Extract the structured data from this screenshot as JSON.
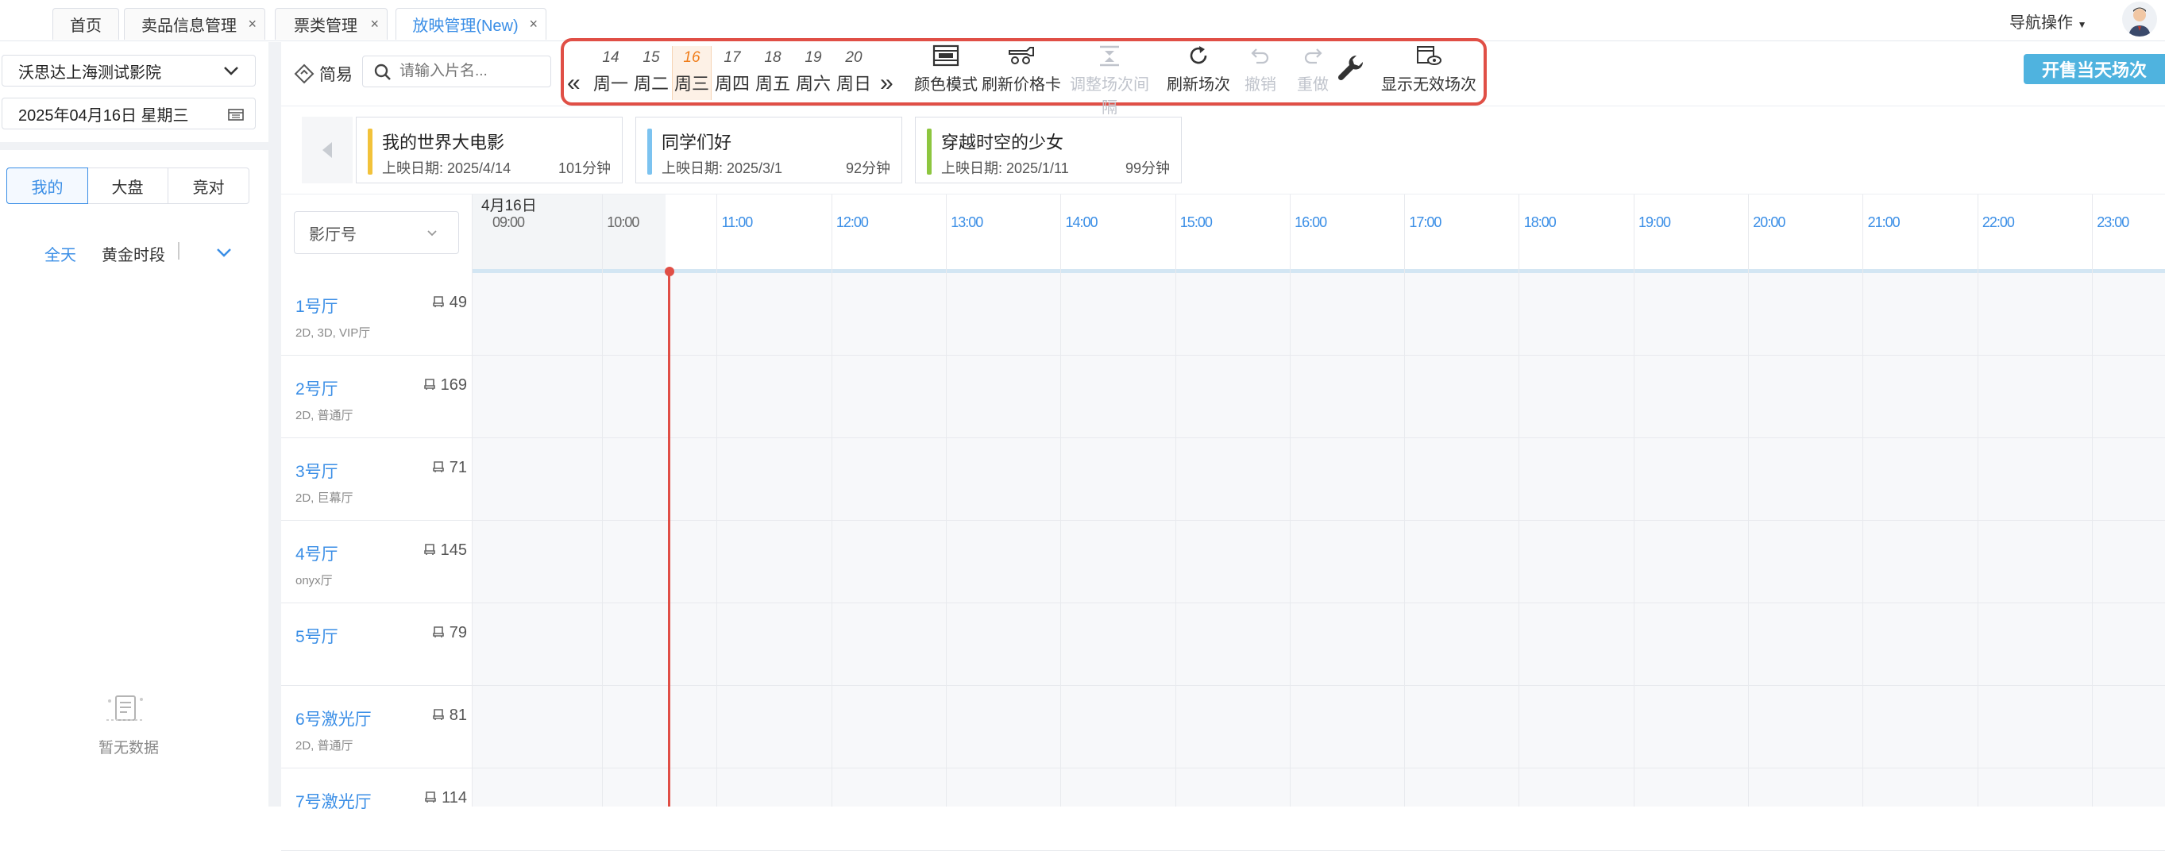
{
  "tabs": [
    {
      "label": "首页",
      "closable": false
    },
    {
      "label": "卖品信息管理",
      "closable": true
    },
    {
      "label": "票类管理",
      "closable": true
    },
    {
      "label": "放映管理(New)",
      "closable": true
    }
  ],
  "nav_menu_label": "导航操作",
  "cinema_select": "沃思达上海测试影院",
  "date_select": "2025年04月16日 星期三",
  "segment": [
    "我的",
    "大盘",
    "竞对"
  ],
  "time_filters": {
    "all": "全天",
    "golden": "黄金时段"
  },
  "empty_text": "暂无数据",
  "mode_label": "简易",
  "search_placeholder": "请输入片名...",
  "week_days": [
    {
      "num": "14",
      "label": "周一"
    },
    {
      "num": "15",
      "label": "周二"
    },
    {
      "num": "16",
      "label": "周三",
      "active": true
    },
    {
      "num": "17",
      "label": "周四"
    },
    {
      "num": "18",
      "label": "周五"
    },
    {
      "num": "19",
      "label": "周六"
    },
    {
      "num": "20",
      "label": "周日"
    }
  ],
  "tools": {
    "color_mode": "颜色模式",
    "refresh_price": "刷新价格卡",
    "adjust_interval": "调整场次间隔",
    "refresh_sessions": "刷新场次",
    "undo": "撤销",
    "redo": "重做",
    "show_invalid": "显示无效场次"
  },
  "open_sale_button": "开售当天场次",
  "movies": [
    {
      "title": "我的世界大电影",
      "date": "上映日期: 2025/4/14",
      "duration": "101分钟",
      "color": "#f2c23a"
    },
    {
      "title": "同学们好",
      "date": "上映日期: 2025/3/1",
      "duration": "92分钟",
      "color": "#7cc3f0"
    },
    {
      "title": "穿越时空的少女",
      "date": "上映日期: 2025/1/11",
      "duration": "99分钟",
      "color": "#8dc63f"
    }
  ],
  "hall_filter": "影厅号",
  "timeline_date": "4月16日",
  "hours": [
    "09:00",
    "10:00",
    "11:00",
    "12:00",
    "13:00",
    "14:00",
    "15:00",
    "16:00",
    "17:00",
    "18:00",
    "19:00",
    "20:00",
    "21:00",
    "22:00",
    "23:00"
  ],
  "halls": [
    {
      "name": "1号厅",
      "seats": "49",
      "type": "2D, 3D, VIP厅"
    },
    {
      "name": "2号厅",
      "seats": "169",
      "type": "2D, 普通厅"
    },
    {
      "name": "3号厅",
      "seats": "71",
      "type": "2D, 巨幕厅"
    },
    {
      "name": "4号厅",
      "seats": "145",
      "type": "onyx厅"
    },
    {
      "name": "5号厅",
      "seats": "79",
      "type": ""
    },
    {
      "name": "6号激光厅",
      "seats": "81",
      "type": "2D, 普通厅"
    },
    {
      "name": "7号激光厅",
      "seats": "114",
      "type": ""
    }
  ],
  "colors": {
    "accent": "#3a8ee6",
    "highlight_box": "#e04f46",
    "now_line": "#e04f46",
    "open_sale_bg": "#4fb3df"
  }
}
